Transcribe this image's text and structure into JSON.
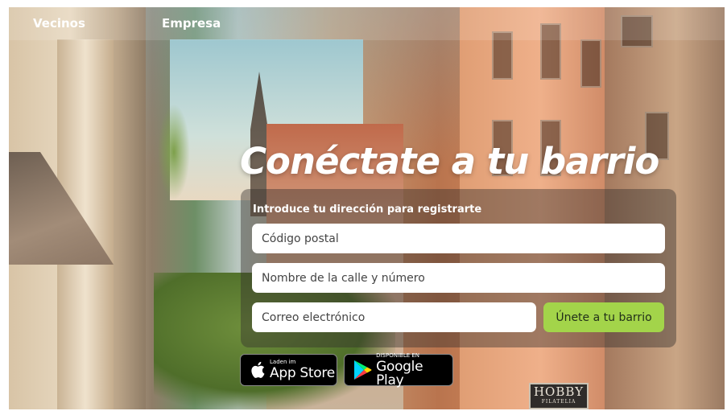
{
  "nav": {
    "vecinos": "Vecinos",
    "empresa": "Empresa"
  },
  "hero": {
    "headline": "Conéctate a tu barrio"
  },
  "signup": {
    "label": "Introduce tu dirección para registrarte",
    "postal_placeholder": "Código postal",
    "street_placeholder": "Nombre de la calle y número",
    "email_placeholder": "Correo electrónico",
    "submit_label": "Únete a tu barrio"
  },
  "stores": {
    "apple": {
      "small": "Laden im",
      "big": "App Store",
      "icon": "apple-icon"
    },
    "google": {
      "small": "DISPONIBLE EN",
      "big": "Google Play",
      "icon": "google-play-icon"
    }
  },
  "background_sign": {
    "line1": "HOBBY",
    "line2": "FILATELIA"
  },
  "colors": {
    "accent_button": "#a3d44a",
    "panel_overlay": "rgba(50,45,42,0.42)",
    "text": "#ffffff"
  }
}
